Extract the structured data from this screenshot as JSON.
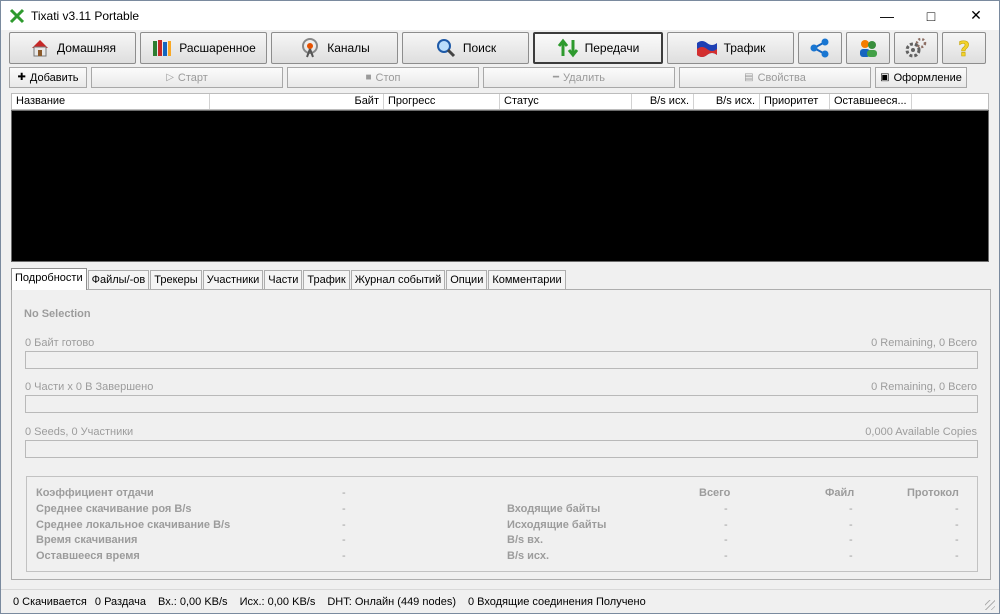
{
  "window": {
    "title": "Tixati v3.11 Portable",
    "min_glyph": "—",
    "max_glyph": "□",
    "close_glyph": "✕"
  },
  "nav": {
    "home": "Домашняя",
    "advanced": "Расшаренное",
    "channels": "Каналы",
    "search": "Поиск",
    "transfers": "Передачи",
    "traffic": "Трафик"
  },
  "toolbar": {
    "add": "Добавить",
    "start": "Старт",
    "stop": "Стоп",
    "delete": "Удалить",
    "properties": "Свойства",
    "appearance": "Оформление"
  },
  "columns": [
    "Название",
    "Байт",
    "Прогресс",
    "Статус",
    "B/s исх.",
    "B/s исх.",
    "Приоритет",
    "Оставшееся..."
  ],
  "tabs": [
    "Подробности",
    "Файлы/-ов",
    "Трекеры",
    "Участники",
    "Части",
    "Трафик",
    "Журнал событий",
    "Опции",
    "Комментарии"
  ],
  "details": {
    "no_selection": "No Selection",
    "bytes_done": "0 Байт готово",
    "bytes_remaining": "0 Remaining,  0 Всего",
    "pieces": "0 Части  x  0 В Завершено",
    "pieces_remaining": "0 Remaining,  0 Всего",
    "seeds": "0 Seeds, 0 Участники",
    "copies": "0,000 Available Copies"
  },
  "stats": {
    "labels_left": [
      "Коэффициент отдачи",
      "Среднее скачивание роя B/s",
      "Среднее локальное скачивание B/s",
      "Время скачивания",
      "Оставшееся время"
    ],
    "values_left": [
      "-",
      "-",
      "-",
      "-",
      "-"
    ],
    "labels_mid": [
      "Входящие байты",
      "Исходящие байты",
      "B/s вх.",
      "B/s исх."
    ],
    "col_total": "Всего",
    "col_file": "Файл",
    "col_protocol": "Протокол",
    "dash": "-"
  },
  "status": {
    "downloading": "0 Скачивается",
    "seeding": "0 Раздача",
    "in": "Вх.: 0,00 KB/s",
    "out": "Исх.: 0,00 KB/s",
    "dht": "DHT: Онлайн (449 nodes)",
    "incoming": "0 Входящие соединения Получено"
  },
  "icons": {
    "app": "tixati-logo-icon",
    "home": "house-icon",
    "shared": "books-icon",
    "channels": "antenna-icon",
    "search": "magnifier-icon",
    "transfers": "arrows-icon",
    "traffic": "flag-icon",
    "network": "network-icon",
    "users": "users-icon",
    "settings": "gears-icon",
    "help": "help-icon"
  },
  "colors": {
    "accent_green": "#2e9a2e",
    "list_bg": "#000000",
    "disabled_text": "#9c9c9c"
  }
}
